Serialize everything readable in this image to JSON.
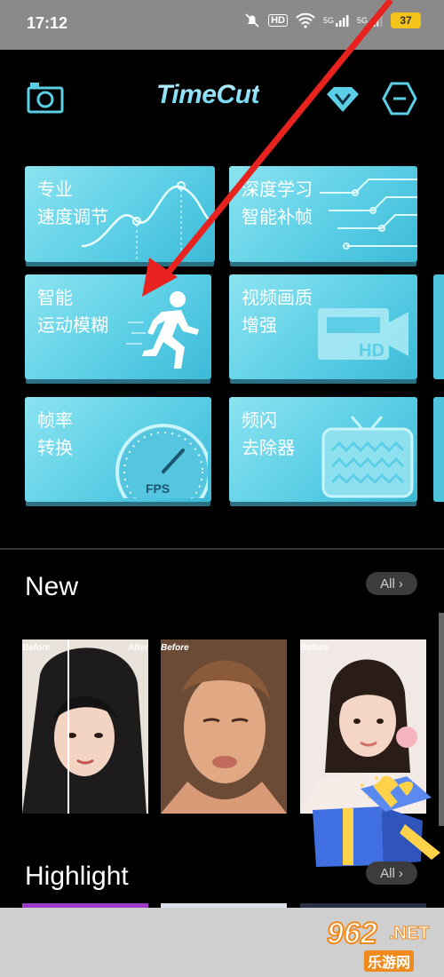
{
  "status_bar": {
    "time": "17:12",
    "hd_label": "HD",
    "signal_label": "5G",
    "battery": "37"
  },
  "header": {
    "title": "TimeCut",
    "camera_icon": "camera-icon",
    "vip_icon": "diamond-vip-icon",
    "settings_icon": "hexagon-menu-icon"
  },
  "features": [
    {
      "label": "专业\n速度调节",
      "icon": "speed-curve-icon"
    },
    {
      "label": "深度学习\n智能补帧",
      "icon": "circuit-icon"
    },
    {
      "label": "智能\n运动模糊",
      "icon": "running-man-icon"
    },
    {
      "label": "视频画质\n增强",
      "icon": "hd-camera-icon"
    },
    {
      "label": "帧率\n转换",
      "icon": "fps-gauge-icon"
    },
    {
      "label": "频闪\n去除器",
      "icon": "tv-icon"
    }
  ],
  "speed_icon_text": "FPS",
  "hd_icon_text": "HD",
  "sections": {
    "new": {
      "title": "New",
      "all_label": "All"
    },
    "highlight": {
      "title": "Highlight",
      "all_label": "All"
    }
  },
  "thumbnails": [
    {
      "before": "Before",
      "after": "After"
    },
    {
      "before": "Before"
    },
    {
      "before": "Before"
    }
  ],
  "watermark": {
    "number": "962",
    "suffix": ".NET",
    "subtitle": "乐游网"
  },
  "colors": {
    "accent": "#5ccfe6",
    "arrow": "#e8231f"
  }
}
